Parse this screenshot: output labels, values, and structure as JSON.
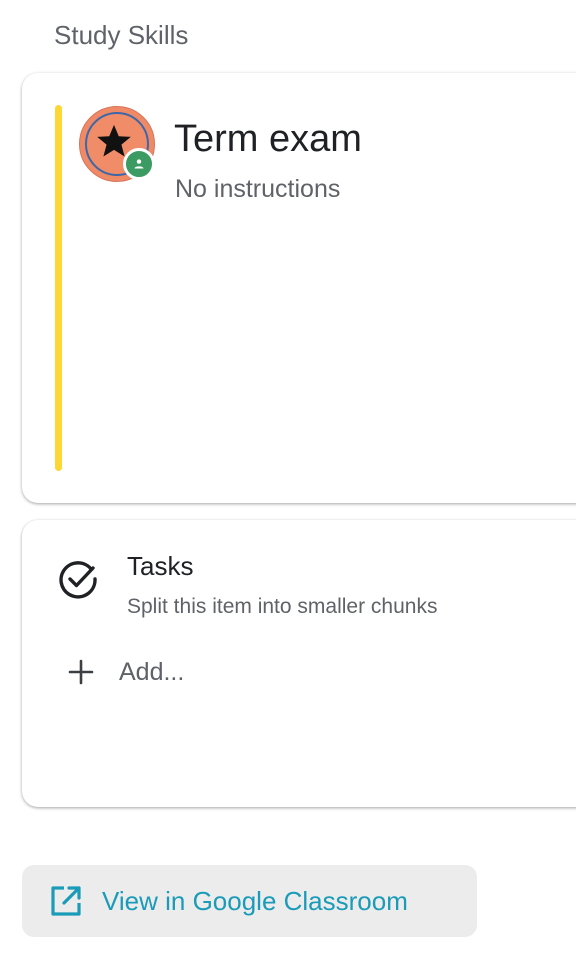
{
  "course": {
    "title": "Study Skills"
  },
  "assignment": {
    "title": "Term exam",
    "subtitle": "No instructions",
    "accent_color": "#fdd835",
    "avatar_icon": "star-icon",
    "badge_icon": "google-classroom-icon"
  },
  "tasks": {
    "icon": "check-circle-icon",
    "title": "Tasks",
    "subtitle": "Split this item into smaller chunks",
    "add_icon": "plus-icon",
    "add_label": "Add..."
  },
  "footer": {
    "icon": "open-in-new-icon",
    "button_label": "View in Google Classroom",
    "link_color": "#1a9bb8"
  }
}
